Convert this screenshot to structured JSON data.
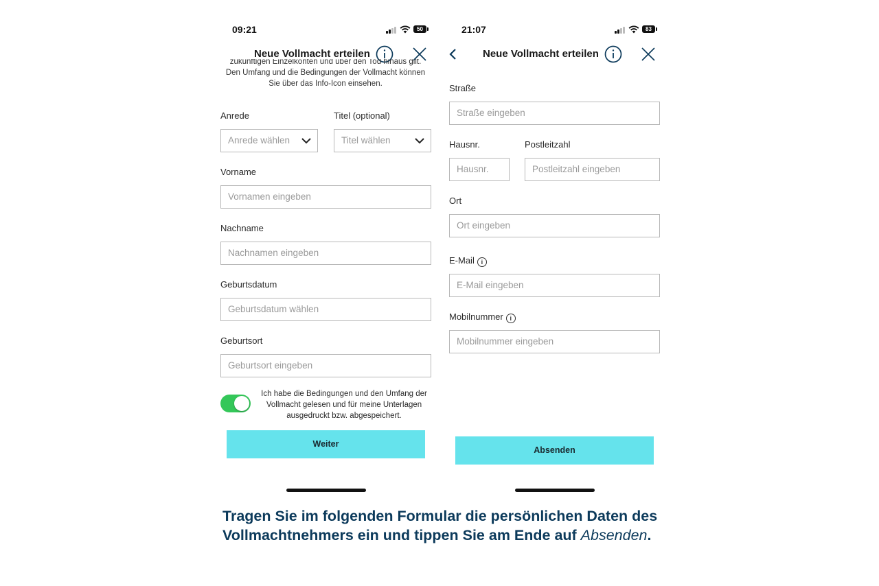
{
  "left": {
    "status": {
      "time": "09:21",
      "battery": "50"
    },
    "nav": {
      "title": "Neue Vollmacht erteilen",
      "info_icon": "info-circle-icon",
      "close_icon": "close-icon"
    },
    "intro": {
      "line1": "zukünftigen Einzelkonten und über den Tod hinaus gilt.",
      "line2": "Den Umfang und die Bedingungen der Vollmacht können",
      "line3": "Sie über das Info-Icon einsehen."
    },
    "anrede": {
      "label": "Anrede",
      "placeholder": "Anrede wählen"
    },
    "titel": {
      "label": "Titel (optional)",
      "placeholder": "Titel wählen"
    },
    "vorname": {
      "label": "Vorname",
      "placeholder": "Vornamen eingeben"
    },
    "nachname": {
      "label": "Nachname",
      "placeholder": "Nachnamen eingeben"
    },
    "geburtsdatum": {
      "label": "Geburtsdatum",
      "placeholder": "Geburtsdatum wählen"
    },
    "geburtsort": {
      "label": "Geburtsort",
      "placeholder": "Geburtsort eingeben"
    },
    "consent": {
      "checked": true,
      "line1": "Ich habe die Bedingungen und den Umfang der",
      "line2": "Vollmacht gelesen und für meine Unterlagen",
      "line3": "ausgedruckt bzw. abgespeichert."
    },
    "button": "Weiter"
  },
  "right": {
    "status": {
      "time": "21:07",
      "battery": "83"
    },
    "nav": {
      "title": "Neue Vollmacht erteilen",
      "back_icon": "chevron-left-icon",
      "info_icon": "info-circle-icon",
      "close_icon": "close-icon"
    },
    "strasse": {
      "label": "Straße",
      "placeholder": "Straße eingeben"
    },
    "hausnr": {
      "label": "Hausnr.",
      "placeholder": "Hausnr."
    },
    "plz": {
      "label": "Postleitzahl",
      "placeholder": "Postleitzahl eingeben"
    },
    "ort": {
      "label": "Ort",
      "placeholder": "Ort eingeben"
    },
    "email": {
      "label": "E-Mail",
      "placeholder": "E-Mail eingeben",
      "info": "i"
    },
    "mobil": {
      "label": "Mobilnummer",
      "placeholder": "Mobilnummer eingeben",
      "info": "i"
    },
    "button": "Absenden"
  },
  "caption": {
    "text1": "Tragen Sie im folgenden Formular die persönlichen Daten des",
    "text2": "Vollmachtnehmers ein und tippen Sie am Ende auf ",
    "emphasis": "Absenden",
    "end": "."
  },
  "colors": {
    "accent": "#65e3ec",
    "toggle_on": "#34c759",
    "caption": "#0c3a5b"
  }
}
